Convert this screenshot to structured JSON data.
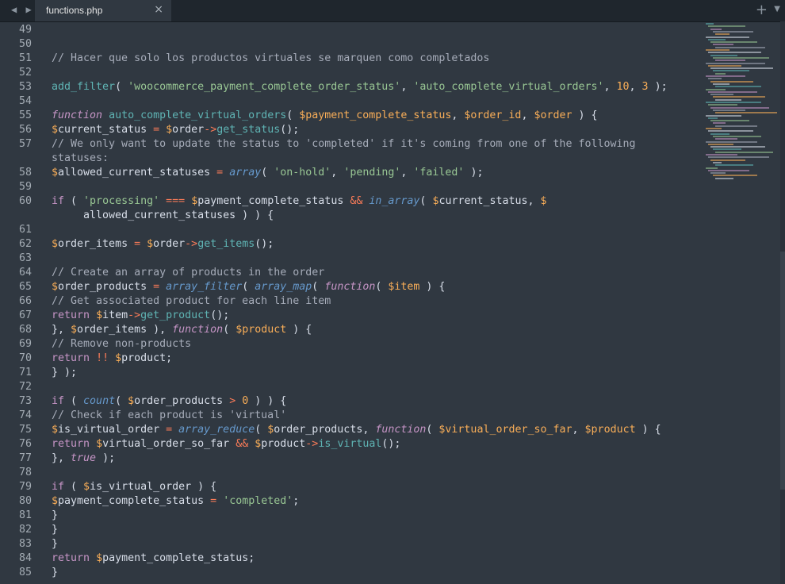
{
  "tabbar": {
    "nav_arrows": "◀ ▶",
    "tab_title": "functions.php",
    "close_glyph": "×",
    "new_tab_glyph": "+",
    "dropdown_glyph": "▼"
  },
  "colors": {
    "background": "#303841",
    "comment": "#a6acb9",
    "function": "#5fb4b4",
    "string": "#99c794",
    "number": "#f9ae58",
    "keyword": "#c695c6",
    "operator": "#f97b58",
    "builtin": "#6699cc"
  },
  "editor": {
    "lines": [
      {
        "num": "49",
        "tokens": []
      },
      {
        "num": "50",
        "tokens": []
      },
      {
        "num": "51",
        "tokens": [
          {
            "t": "// Hacer que solo los productos virtuales se marquen como completados",
            "c": "comment"
          }
        ]
      },
      {
        "num": "52",
        "tokens": []
      },
      {
        "num": "53",
        "tokens": [
          {
            "t": "add_filter",
            "c": "builtin-plain"
          },
          {
            "t": "( ",
            "c": "punct"
          },
          {
            "t": "'woocommerce_payment_complete_order_status'",
            "c": "string"
          },
          {
            "t": ", ",
            "c": "punct"
          },
          {
            "t": "'auto_complete_virtual_orders'",
            "c": "string"
          },
          {
            "t": ", ",
            "c": "punct"
          },
          {
            "t": "10",
            "c": "number"
          },
          {
            "t": ", ",
            "c": "punct"
          },
          {
            "t": "3",
            "c": "number"
          },
          {
            "t": " );",
            "c": "punct"
          }
        ]
      },
      {
        "num": "54",
        "tokens": []
      },
      {
        "num": "55",
        "tokens": [
          {
            "t": "function",
            "c": "keyword"
          },
          {
            "t": " ",
            "c": "punct"
          },
          {
            "t": "auto_complete_virtual_orders",
            "c": "defname"
          },
          {
            "t": "( ",
            "c": "punct"
          },
          {
            "t": "$payment_complete_status",
            "c": "param"
          },
          {
            "t": ", ",
            "c": "punct"
          },
          {
            "t": "$order_id",
            "c": "param"
          },
          {
            "t": ", ",
            "c": "punct"
          },
          {
            "t": "$order",
            "c": "param"
          },
          {
            "t": " ) {",
            "c": "punct"
          }
        ]
      },
      {
        "num": "56",
        "tokens": [
          {
            "t": "$",
            "c": "dollar"
          },
          {
            "t": "current_status ",
            "c": "var"
          },
          {
            "t": "=",
            "c": "operator"
          },
          {
            "t": " ",
            "c": "punct"
          },
          {
            "t": "$",
            "c": "dollar"
          },
          {
            "t": "order",
            "c": "var"
          },
          {
            "t": "->",
            "c": "operator"
          },
          {
            "t": "get_status",
            "c": "func"
          },
          {
            "t": "();",
            "c": "punct"
          }
        ]
      },
      {
        "num": "57",
        "tokens": [
          {
            "t": "// We only want to update the status to 'completed' if it's coming from one of the following",
            "c": "comment"
          }
        ]
      },
      {
        "num": "",
        "tokens": [
          {
            "t": "statuses:",
            "c": "comment"
          }
        ]
      },
      {
        "num": "58",
        "tokens": [
          {
            "t": "$",
            "c": "dollar"
          },
          {
            "t": "allowed_current_statuses ",
            "c": "var"
          },
          {
            "t": "=",
            "c": "operator"
          },
          {
            "t": " ",
            "c": "punct"
          },
          {
            "t": "array",
            "c": "builtin"
          },
          {
            "t": "( ",
            "c": "punct"
          },
          {
            "t": "'on-hold'",
            "c": "string"
          },
          {
            "t": ", ",
            "c": "punct"
          },
          {
            "t": "'pending'",
            "c": "string"
          },
          {
            "t": ", ",
            "c": "punct"
          },
          {
            "t": "'failed'",
            "c": "string"
          },
          {
            "t": " );",
            "c": "punct"
          }
        ]
      },
      {
        "num": "59",
        "tokens": []
      },
      {
        "num": "60",
        "tokens": [
          {
            "t": "if",
            "c": "return"
          },
          {
            "t": " ( ",
            "c": "punct"
          },
          {
            "t": "'processing'",
            "c": "string"
          },
          {
            "t": " ",
            "c": "punct"
          },
          {
            "t": "===",
            "c": "operator"
          },
          {
            "t": " ",
            "c": "punct"
          },
          {
            "t": "$",
            "c": "dollar"
          },
          {
            "t": "payment_complete_status ",
            "c": "var"
          },
          {
            "t": "&&",
            "c": "operator"
          },
          {
            "t": " ",
            "c": "punct"
          },
          {
            "t": "in_array",
            "c": "builtin"
          },
          {
            "t": "( ",
            "c": "punct"
          },
          {
            "t": "$",
            "c": "dollar"
          },
          {
            "t": "current_status, ",
            "c": "var"
          },
          {
            "t": "$",
            "c": "dollar"
          }
        ]
      },
      {
        "num": "",
        "tokens": [
          {
            "t": "     allowed_current_statuses ) ) {",
            "c": "var"
          }
        ]
      },
      {
        "num": "61",
        "tokens": []
      },
      {
        "num": "62",
        "tokens": [
          {
            "t": "$",
            "c": "dollar"
          },
          {
            "t": "order_items ",
            "c": "var"
          },
          {
            "t": "=",
            "c": "operator"
          },
          {
            "t": " ",
            "c": "punct"
          },
          {
            "t": "$",
            "c": "dollar"
          },
          {
            "t": "order",
            "c": "var"
          },
          {
            "t": "->",
            "c": "operator"
          },
          {
            "t": "get_items",
            "c": "func"
          },
          {
            "t": "();",
            "c": "punct"
          }
        ]
      },
      {
        "num": "63",
        "tokens": []
      },
      {
        "num": "64",
        "tokens": [
          {
            "t": "// Create an array of products in the order",
            "c": "comment"
          }
        ]
      },
      {
        "num": "65",
        "tokens": [
          {
            "t": "$",
            "c": "dollar"
          },
          {
            "t": "order_products ",
            "c": "var"
          },
          {
            "t": "=",
            "c": "operator"
          },
          {
            "t": " ",
            "c": "punct"
          },
          {
            "t": "array_filter",
            "c": "builtin"
          },
          {
            "t": "( ",
            "c": "punct"
          },
          {
            "t": "array_map",
            "c": "builtin"
          },
          {
            "t": "( ",
            "c": "punct"
          },
          {
            "t": "function",
            "c": "keyword"
          },
          {
            "t": "( ",
            "c": "punct"
          },
          {
            "t": "$item",
            "c": "param"
          },
          {
            "t": " ) {",
            "c": "punct"
          }
        ]
      },
      {
        "num": "66",
        "tokens": [
          {
            "t": "// Get associated product for each line item",
            "c": "comment"
          }
        ]
      },
      {
        "num": "67",
        "tokens": [
          {
            "t": "return",
            "c": "return"
          },
          {
            "t": " ",
            "c": "punct"
          },
          {
            "t": "$",
            "c": "dollar"
          },
          {
            "t": "item",
            "c": "var"
          },
          {
            "t": "->",
            "c": "operator"
          },
          {
            "t": "get_product",
            "c": "func"
          },
          {
            "t": "();",
            "c": "punct"
          }
        ]
      },
      {
        "num": "68",
        "tokens": [
          {
            "t": "}, ",
            "c": "punct"
          },
          {
            "t": "$",
            "c": "dollar"
          },
          {
            "t": "order_items ), ",
            "c": "var"
          },
          {
            "t": "function",
            "c": "keyword"
          },
          {
            "t": "( ",
            "c": "punct"
          },
          {
            "t": "$product",
            "c": "param"
          },
          {
            "t": " ) {",
            "c": "punct"
          }
        ]
      },
      {
        "num": "69",
        "tokens": [
          {
            "t": "// Remove non-products",
            "c": "comment"
          }
        ]
      },
      {
        "num": "70",
        "tokens": [
          {
            "t": "return",
            "c": "return"
          },
          {
            "t": " ",
            "c": "punct"
          },
          {
            "t": "!!",
            "c": "operator"
          },
          {
            "t": " ",
            "c": "punct"
          },
          {
            "t": "$",
            "c": "dollar"
          },
          {
            "t": "product;",
            "c": "var"
          }
        ]
      },
      {
        "num": "71",
        "tokens": [
          {
            "t": "} );",
            "c": "punct"
          }
        ]
      },
      {
        "num": "72",
        "tokens": []
      },
      {
        "num": "73",
        "tokens": [
          {
            "t": "if",
            "c": "return"
          },
          {
            "t": " ( ",
            "c": "punct"
          },
          {
            "t": "count",
            "c": "builtin"
          },
          {
            "t": "( ",
            "c": "punct"
          },
          {
            "t": "$",
            "c": "dollar"
          },
          {
            "t": "order_products ",
            "c": "var"
          },
          {
            "t": ">",
            "c": "operator"
          },
          {
            "t": " ",
            "c": "punct"
          },
          {
            "t": "0",
            "c": "number"
          },
          {
            "t": " ) ) {",
            "c": "punct"
          }
        ]
      },
      {
        "num": "74",
        "tokens": [
          {
            "t": "// Check if each product is 'virtual'",
            "c": "comment"
          }
        ]
      },
      {
        "num": "75",
        "tokens": [
          {
            "t": "$",
            "c": "dollar"
          },
          {
            "t": "is_virtual_order ",
            "c": "var"
          },
          {
            "t": "=",
            "c": "operator"
          },
          {
            "t": " ",
            "c": "punct"
          },
          {
            "t": "array_reduce",
            "c": "builtin"
          },
          {
            "t": "( ",
            "c": "punct"
          },
          {
            "t": "$",
            "c": "dollar"
          },
          {
            "t": "order_products, ",
            "c": "var"
          },
          {
            "t": "function",
            "c": "keyword"
          },
          {
            "t": "( ",
            "c": "punct"
          },
          {
            "t": "$virtual_order_so_far",
            "c": "param"
          },
          {
            "t": ", ",
            "c": "punct"
          },
          {
            "t": "$product",
            "c": "param"
          },
          {
            "t": " ) {",
            "c": "punct"
          }
        ]
      },
      {
        "num": "76",
        "tokens": [
          {
            "t": "return",
            "c": "return"
          },
          {
            "t": " ",
            "c": "punct"
          },
          {
            "t": "$",
            "c": "dollar"
          },
          {
            "t": "virtual_order_so_far ",
            "c": "var"
          },
          {
            "t": "&&",
            "c": "operator"
          },
          {
            "t": " ",
            "c": "punct"
          },
          {
            "t": "$",
            "c": "dollar"
          },
          {
            "t": "product",
            "c": "var"
          },
          {
            "t": "->",
            "c": "operator"
          },
          {
            "t": "is_virtual",
            "c": "func"
          },
          {
            "t": "();",
            "c": "punct"
          }
        ]
      },
      {
        "num": "77",
        "tokens": [
          {
            "t": "}, ",
            "c": "punct"
          },
          {
            "t": "true",
            "c": "bool"
          },
          {
            "t": " );",
            "c": "punct"
          }
        ]
      },
      {
        "num": "78",
        "tokens": []
      },
      {
        "num": "79",
        "tokens": [
          {
            "t": "if",
            "c": "return"
          },
          {
            "t": " ( ",
            "c": "punct"
          },
          {
            "t": "$",
            "c": "dollar"
          },
          {
            "t": "is_virtual_order ) {",
            "c": "var"
          }
        ]
      },
      {
        "num": "80",
        "tokens": [
          {
            "t": "$",
            "c": "dollar"
          },
          {
            "t": "payment_complete_status ",
            "c": "var"
          },
          {
            "t": "=",
            "c": "operator"
          },
          {
            "t": " ",
            "c": "punct"
          },
          {
            "t": "'completed'",
            "c": "string"
          },
          {
            "t": ";",
            "c": "punct"
          }
        ]
      },
      {
        "num": "81",
        "tokens": [
          {
            "t": "}",
            "c": "punct"
          }
        ]
      },
      {
        "num": "82",
        "tokens": [
          {
            "t": "}",
            "c": "punct"
          }
        ]
      },
      {
        "num": "83",
        "tokens": [
          {
            "t": "}",
            "c": "punct"
          }
        ]
      },
      {
        "num": "84",
        "tokens": [
          {
            "t": "return",
            "c": "return"
          },
          {
            "t": " ",
            "c": "punct"
          },
          {
            "t": "$",
            "c": "dollar"
          },
          {
            "t": "payment_complete_status;",
            "c": "var"
          }
        ]
      },
      {
        "num": "85",
        "tokens": [
          {
            "t": "}",
            "c": "punct"
          }
        ]
      }
    ]
  }
}
